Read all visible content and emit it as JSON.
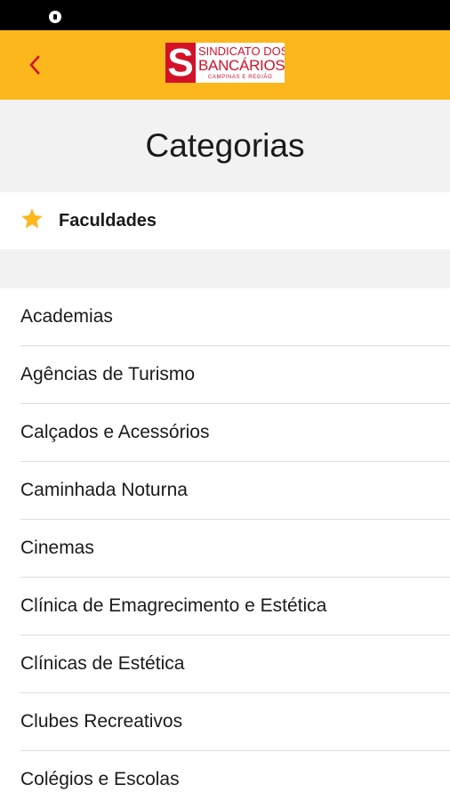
{
  "header": {
    "back_icon": "chevron-left-icon",
    "logo": {
      "line1": "SINDICATO DOS",
      "line2": "BANCÁRIOS",
      "line3": "CAMPINAS E REGIÃO",
      "mark": "S"
    },
    "brand_color": "#fcb71c",
    "accent_color": "#d3122a"
  },
  "page_title": "Categorias",
  "favorites": {
    "icon": "star-icon",
    "label": "Faculdades",
    "icon_color": "#fcb71c"
  },
  "categories": [
    "Academias",
    "Agências de Turismo",
    "Calçados e Acessórios",
    "Caminhada Noturna",
    "Cinemas",
    "Clínica de Emagrecimento e Estética",
    "Clínicas de Estética",
    "Clubes Recreativos",
    "Colégios e Escolas"
  ]
}
